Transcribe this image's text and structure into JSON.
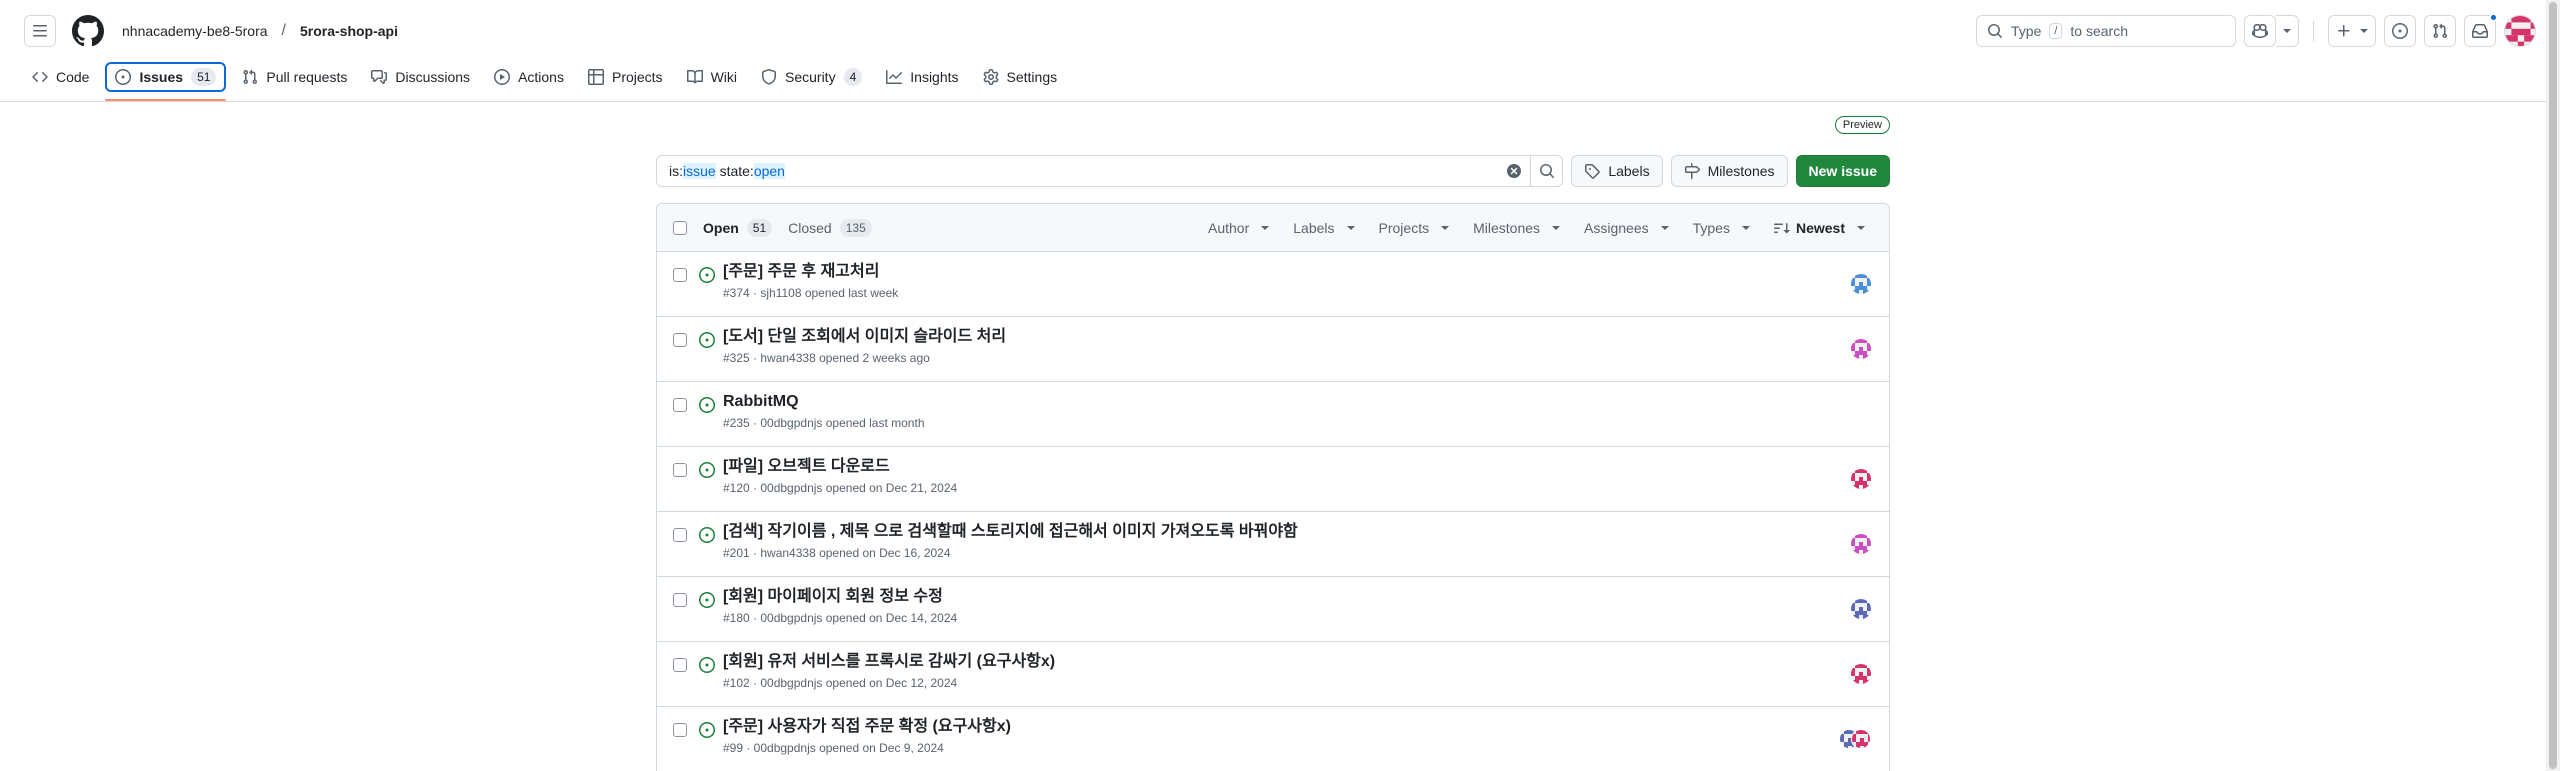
{
  "header": {
    "owner": "nhnacademy-be8-5rora",
    "separator": "/",
    "repo": "5rora-shop-api",
    "search_prefix": "Type",
    "search_key": "/",
    "search_suffix": "to search"
  },
  "tabs": [
    {
      "label": "Code",
      "icon": "code-icon"
    },
    {
      "label": "Issues",
      "icon": "issue-opened-icon",
      "count": "51",
      "selected": true
    },
    {
      "label": "Pull requests",
      "icon": "git-pull-request-icon"
    },
    {
      "label": "Discussions",
      "icon": "comment-discussion-icon"
    },
    {
      "label": "Actions",
      "icon": "play-icon"
    },
    {
      "label": "Projects",
      "icon": "table-icon"
    },
    {
      "label": "Wiki",
      "icon": "book-icon"
    },
    {
      "label": "Security",
      "icon": "shield-icon",
      "count": "4"
    },
    {
      "label": "Insights",
      "icon": "graph-icon"
    },
    {
      "label": "Settings",
      "icon": "gear-icon"
    }
  ],
  "main": {
    "preview_badge": "Preview",
    "query": {
      "k1": "is:",
      "v1": "issue",
      "k2": " state:",
      "v2": "open"
    },
    "labels_button": "Labels",
    "milestones_button": "Milestones",
    "new_issue_button": "New issue",
    "open_label": "Open",
    "open_count": "51",
    "closed_label": "Closed",
    "closed_count": "135",
    "filters": [
      "Author",
      "Labels",
      "Projects",
      "Milestones",
      "Assignees",
      "Types"
    ],
    "sort_label": "Newest"
  },
  "issues": [
    {
      "title": "[주문] 주문 후 재고처리",
      "meta": "#374 · sjh1108 opened last week",
      "avatar_color": "#4a90d9"
    },
    {
      "title": "[도서] 단일 조회에서 이미지 슬라이드 처리",
      "meta": "#325 · hwan4338 opened 2 weeks ago",
      "avatar_color": "#c94fc2"
    },
    {
      "title": "RabbitMQ",
      "meta": "#235 · 00dbgpdnjs opened last month",
      "avatar_color": ""
    },
    {
      "title": "[파일] 오브젝트 다운로드",
      "meta": "#120 · 00dbgpdnjs opened on Dec 21, 2024",
      "avatar_color": "#d6336c"
    },
    {
      "title": "[검색] 작기이름 , 제목 으로 검색할때 스토리지에 접근해서 이미지 가져오도록 바꿔야함",
      "meta": "#201 · hwan4338 opened on Dec 16, 2024",
      "avatar_color": "#c94fc2"
    },
    {
      "title": "[회원] 마이페이지 회원 정보 수정",
      "meta": "#180 · 00dbgpdnjs opened on Dec 14, 2024",
      "avatar_color": "#5a6ab8"
    },
    {
      "title": "[회원] 유저 서비스를 프록시로 감싸기 (요구사항x)",
      "meta": "#102 · 00dbgpdnjs opened on Dec 12, 2024",
      "avatar_color": "#d6336c"
    },
    {
      "title": "[주문] 사용자가 직접 주문 확정 (요구사항x)",
      "meta": "#99 · 00dbgpdnjs opened on Dec 9, 2024",
      "avatar_color": "#d6336c"
    }
  ],
  "colors": {
    "accent": "#0969da",
    "open_green": "#1a7f37",
    "new_issue_green": "#1f883d",
    "tab_underline": "#fd8c73"
  }
}
